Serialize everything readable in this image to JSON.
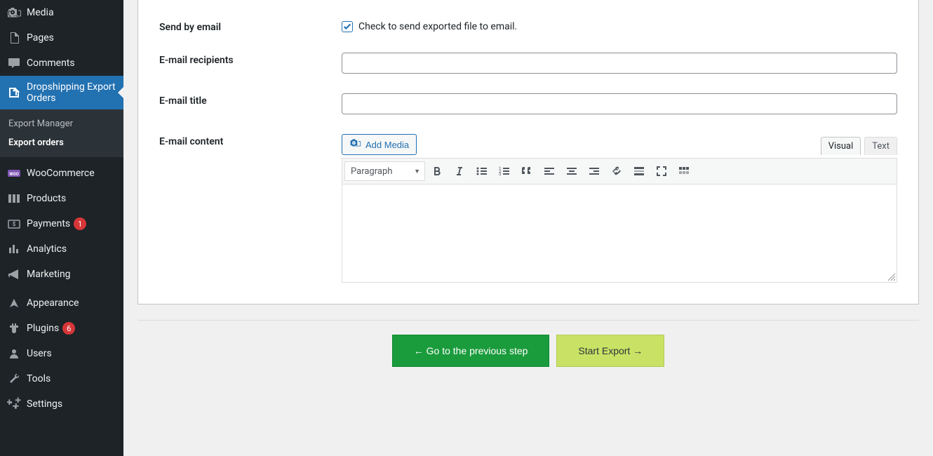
{
  "sidebar": {
    "items": [
      {
        "label": "Media",
        "icon": "media"
      },
      {
        "label": "Pages",
        "icon": "page"
      },
      {
        "label": "Comments",
        "icon": "comment"
      },
      {
        "label": "Dropshipping Export Orders",
        "icon": "export",
        "active": true
      },
      {
        "label": "WooCommerce",
        "icon": "woo"
      },
      {
        "label": "Products",
        "icon": "products"
      },
      {
        "label": "Payments",
        "icon": "payments",
        "badge": "1"
      },
      {
        "label": "Analytics",
        "icon": "analytics"
      },
      {
        "label": "Marketing",
        "icon": "marketing"
      },
      {
        "label": "Appearance",
        "icon": "appearance"
      },
      {
        "label": "Plugins",
        "icon": "plugins",
        "badge": "6"
      },
      {
        "label": "Users",
        "icon": "users"
      },
      {
        "label": "Tools",
        "icon": "tools"
      },
      {
        "label": "Settings",
        "icon": "settings"
      }
    ],
    "submenu": [
      {
        "label": "Export Manager"
      },
      {
        "label": "Export orders",
        "current": true
      }
    ]
  },
  "form": {
    "send_by_email_label": "Send by email",
    "send_by_email_checkbox_label": "Check to send exported file to email.",
    "send_by_email_checked": true,
    "email_recipients_label": "E-mail recipients",
    "email_recipients_value": "",
    "email_title_label": "E-mail title",
    "email_title_value": "",
    "email_content_label": "E-mail content",
    "add_media_label": "Add Media"
  },
  "editor": {
    "tab_visual": "Visual",
    "tab_text": "Text",
    "format_select": "Paragraph"
  },
  "footer": {
    "prev_button": "← Go to the previous step",
    "export_button": "Start Export →"
  }
}
